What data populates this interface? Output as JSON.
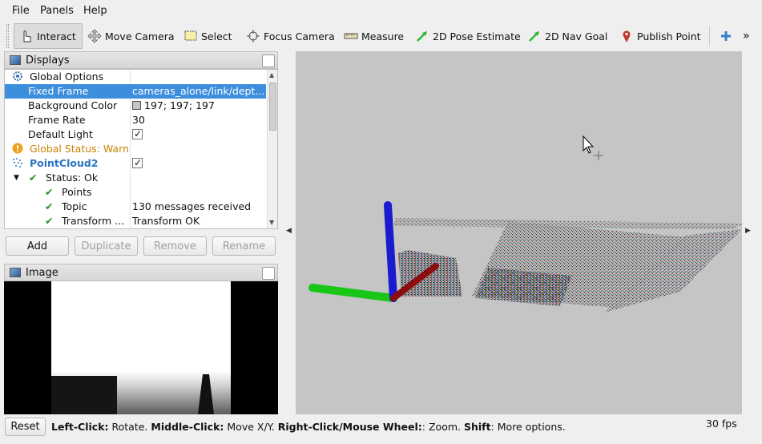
{
  "menu": [
    "File",
    "Panels",
    "Help"
  ],
  "toolbar": {
    "tools": [
      {
        "label": "Interact",
        "icon": "hand-pointer-icon"
      },
      {
        "label": "Move Camera",
        "icon": "move-camera-icon"
      },
      {
        "label": "Select",
        "icon": "select-rect-icon"
      },
      {
        "label": "Focus Camera",
        "icon": "focus-camera-icon"
      },
      {
        "label": "Measure",
        "icon": "ruler-icon"
      },
      {
        "label": "2D Pose Estimate",
        "icon": "green-arrow-icon"
      },
      {
        "label": "2D Nav Goal",
        "icon": "green-arrow-icon"
      },
      {
        "label": "Publish Point",
        "icon": "map-pin-icon"
      }
    ],
    "plus_icon": "plus-icon",
    "overflow": "»"
  },
  "displays": {
    "title": "Displays",
    "rows": [
      {
        "name": "Global Options",
        "value": ""
      },
      {
        "name": "Fixed Frame",
        "value": "cameras_alone/link/dept..."
      },
      {
        "name": "Background Color",
        "value": "197; 197; 197"
      },
      {
        "name": "Frame Rate",
        "value": "30"
      },
      {
        "name": "Default Light",
        "value": ""
      },
      {
        "name": "Global Status: Warn",
        "value": ""
      },
      {
        "name": "PointCloud2",
        "value": ""
      },
      {
        "name": "Status: Ok",
        "value": ""
      },
      {
        "name": "Points",
        "value": ""
      },
      {
        "name": "Topic",
        "value": "130 messages received"
      },
      {
        "name": "Transform ...",
        "value": "Transform OK"
      }
    ],
    "buttons": {
      "add": "Add",
      "duplicate": "Duplicate",
      "remove": "Remove",
      "rename": "Rename"
    }
  },
  "image_panel": {
    "title": "Image"
  },
  "colors": {
    "selection": "#3e8ede",
    "warn": "#d08a00",
    "pointcloud": "#2a73c2",
    "ok": "#2a8a2a",
    "viewport_bg": "#c5c5c5"
  },
  "status": {
    "reset": "Reset",
    "parts": [
      {
        "b": "Left-Click:",
        "t": " Rotate. "
      },
      {
        "b": "Middle-Click:",
        "t": " Move X/Y. "
      },
      {
        "b": "Right-Click/Mouse Wheel:",
        "t": ": Zoom. "
      },
      {
        "b": "Shift",
        "t": ": More options."
      }
    ],
    "fps": "30 fps"
  }
}
